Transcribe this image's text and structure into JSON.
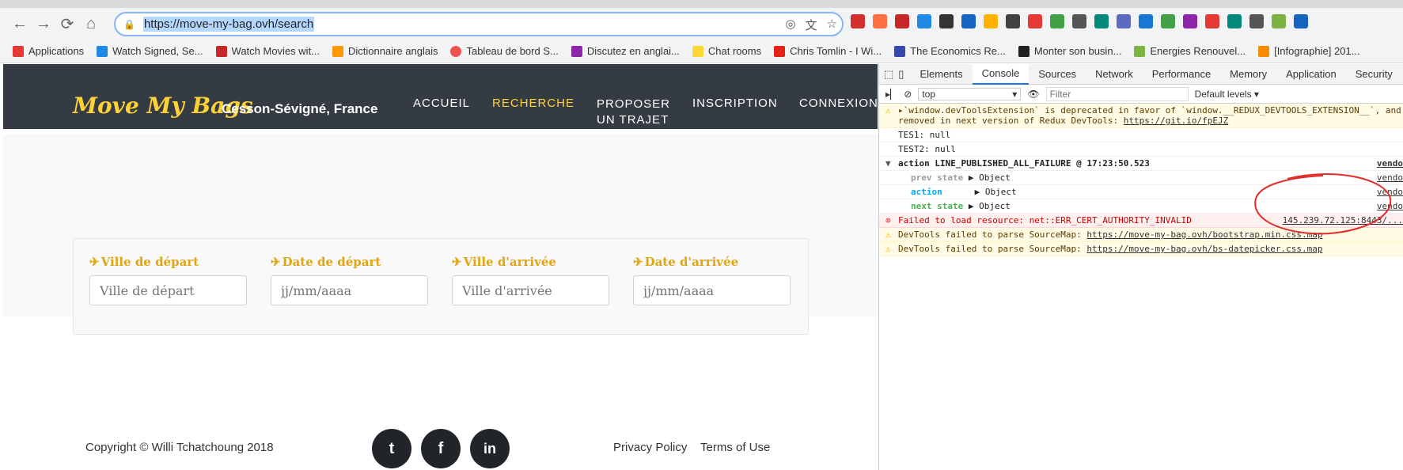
{
  "browser": {
    "url": "https://move-my-bag.ovh/search",
    "bookmarks": [
      {
        "label": "Applications",
        "color": "#e53935"
      },
      {
        "label": "Watch Signed, Se...",
        "color": "#1e88e5"
      },
      {
        "label": "Watch Movies wit...",
        "color": "#c62828"
      },
      {
        "label": "Dictionnaire anglais",
        "color": "#ff9800"
      },
      {
        "label": "Tableau de bord S...",
        "color": "#ef5350"
      },
      {
        "label": "Discutez en anglai...",
        "color": "#8e24aa"
      },
      {
        "label": "Chat rooms",
        "color": "#fdd835"
      },
      {
        "label": "Chris Tomlin - I Wi...",
        "color": "#e62117"
      },
      {
        "label": "The Economics Re...",
        "color": "#3949ab"
      },
      {
        "label": "Monter son busin...",
        "color": "#212121"
      },
      {
        "label": "Energies Renouvel...",
        "color": "#7cb342"
      },
      {
        "label": "[Infographie] 201...",
        "color": "#fb8c00"
      }
    ]
  },
  "site": {
    "logo": "Move My Bags",
    "city": "Cesson-Sévigné, France",
    "nav": [
      "ACCUEIL",
      "RECHERCHE",
      "PROPOSER",
      "UN TRAJET",
      "INSCRIPTION",
      "CONNEXION"
    ],
    "search": {
      "fields": [
        {
          "label": "Ville de départ",
          "placeholder": "Ville de départ"
        },
        {
          "label": "Date de départ",
          "placeholder": "jj/mm/aaaa"
        },
        {
          "label": "Ville d'arrivée",
          "placeholder": "Ville d'arrivée"
        },
        {
          "label": "Date d'arrivée",
          "placeholder": "jj/mm/aaaa"
        }
      ]
    },
    "footer": {
      "copyright": "Copyright © Willi Tchatchoung 2018",
      "privacy": "Privacy Policy",
      "terms": "Terms of Use"
    }
  },
  "devtools": {
    "tabs": [
      "Elements",
      "Console",
      "Sources",
      "Network",
      "Performance",
      "Memory",
      "Application",
      "Security"
    ],
    "context": "top",
    "filter_placeholder": "Filter",
    "levels": "Default levels ▾",
    "lines": {
      "warn1a": "▸`window.devToolsExtension` is deprecated in favor of `window.__REDUX_DEVTOOLS_EXTENSION__`, and",
      "warn1b": "removed in next version of Redux DevTools: ",
      "warn1link": "https://git.io/fpEJZ",
      "tes1": "TES1:  null",
      "test2": "TEST2:  null",
      "action_header": "action LINE_PUBLISHED_ALL_FAILURE @ 17:23:50.523",
      "prev_state": "prev state",
      "action": "action",
      "next_state": "next state",
      "object": "▶ Object",
      "error": "Failed to load resource: net::ERR_CERT_AUTHORITY_INVALID",
      "error_src": "145.239.72.125:8443/...",
      "warn2": "DevTools failed to parse SourceMap: ",
      "warn2link": "https://move-my-bag.ovh/bootstrap.min.css.map",
      "warn3": "DevTools failed to parse SourceMap: ",
      "warn3link": "https://move-my-bag.ovh/bs-datepicker.css.map",
      "vendor": "vendo"
    }
  }
}
